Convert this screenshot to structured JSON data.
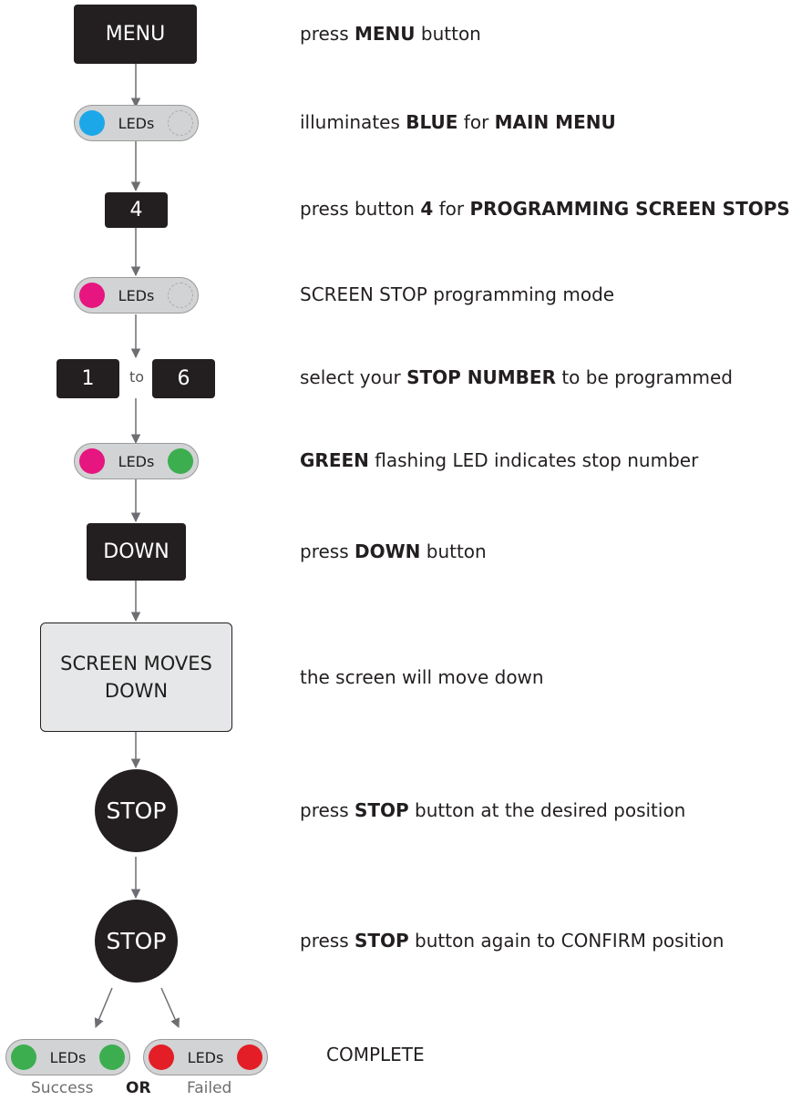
{
  "colors": {
    "button_bg": "#231f20",
    "pill_bg": "#d1d3d4",
    "led_blue": "#1ca8e8",
    "led_magenta": "#e6157f",
    "led_green": "#3cae4f",
    "led_red": "#e31e26",
    "box_bg": "#e6e7e8"
  },
  "flow": {
    "menu_btn": "MENU",
    "leds_label": "LEDs",
    "btn_4": "4",
    "btn_1": "1",
    "range_to": "to",
    "btn_6": "6",
    "down_btn": "DOWN",
    "moves_line1": "SCREEN MOVES",
    "moves_line2": "DOWN",
    "stop_btn": "STOP"
  },
  "results": {
    "success": "Success",
    "or": "OR",
    "failed": "Failed"
  },
  "steps": {
    "s1": {
      "a": "press ",
      "b": "MENU",
      "c": " button"
    },
    "s2": {
      "a": "illuminates ",
      "b": "BLUE",
      "c": " for ",
      "d": "MAIN MENU"
    },
    "s3": {
      "a": "press button ",
      "b": "4",
      "c": " for ",
      "d": "PROGRAMMING SCREEN STOPS"
    },
    "s4": {
      "a": "SCREEN STOP programming mode"
    },
    "s5": {
      "a": "select your ",
      "b": "STOP NUMBER",
      "c": " to be programmed"
    },
    "s6": {
      "a": "GREEN",
      "b": " flashing LED indicates stop number"
    },
    "s7": {
      "a": "press ",
      "b": "DOWN",
      "c": " button"
    },
    "s8": {
      "a": "the screen will move down"
    },
    "s9": {
      "a": "press ",
      "b": "STOP",
      "c": " button at the desired position"
    },
    "s10": {
      "a": "press ",
      "b": "STOP",
      "c": " button again to CONFIRM position"
    },
    "s11": {
      "a": "COMPLETE"
    }
  }
}
